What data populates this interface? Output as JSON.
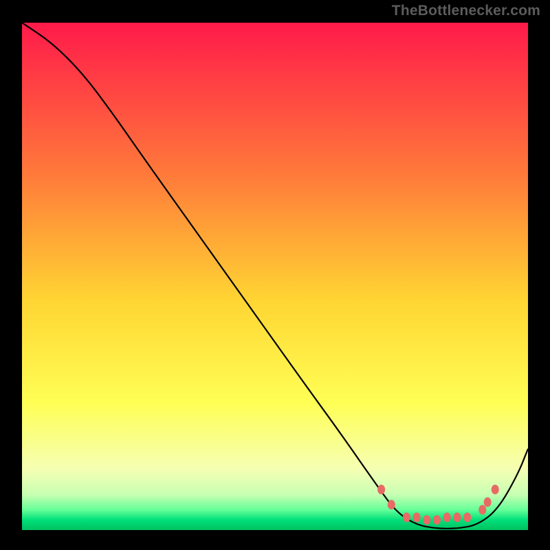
{
  "watermark": "TheBottlenecker.com",
  "chart_data": {
    "type": "line",
    "title": "",
    "xlabel": "",
    "ylabel": "",
    "xlim": [
      0,
      100
    ],
    "ylim": [
      0,
      100
    ],
    "grid": false,
    "series": [
      {
        "name": "bottleneck-curve",
        "x": [
          0,
          6,
          12,
          18,
          25,
          35,
          45,
          55,
          63,
          70,
          74,
          78,
          82,
          86,
          90,
          94,
          98,
          100
        ],
        "y": [
          100,
          96,
          90,
          82,
          72,
          58,
          44,
          30,
          19,
          9,
          3.5,
          1,
          0.3,
          0.3,
          1,
          4,
          11,
          16
        ]
      }
    ],
    "markers": {
      "name": "optimal-zone-markers",
      "color": "#e86a64",
      "points": [
        {
          "x": 71,
          "y": 8
        },
        {
          "x": 73,
          "y": 5
        },
        {
          "x": 76,
          "y": 2.5
        },
        {
          "x": 78,
          "y": 2.5
        },
        {
          "x": 80,
          "y": 2
        },
        {
          "x": 82,
          "y": 2
        },
        {
          "x": 84,
          "y": 2.5
        },
        {
          "x": 86,
          "y": 2.5
        },
        {
          "x": 88,
          "y": 2.5
        },
        {
          "x": 91,
          "y": 4
        },
        {
          "x": 92,
          "y": 5.5
        },
        {
          "x": 93.5,
          "y": 8
        }
      ]
    },
    "background_gradient": {
      "type": "vertical",
      "stops": [
        {
          "pos": 0,
          "color": "#ff1a4a"
        },
        {
          "pos": 30,
          "color": "#ff7a3a"
        },
        {
          "pos": 55,
          "color": "#ffd633"
        },
        {
          "pos": 75,
          "color": "#ffff55"
        },
        {
          "pos": 88,
          "color": "#f5ffb3"
        },
        {
          "pos": 93,
          "color": "#c8ffb3"
        },
        {
          "pos": 96,
          "color": "#66ff99"
        },
        {
          "pos": 98,
          "color": "#00e07a"
        },
        {
          "pos": 100,
          "color": "#00c060"
        }
      ]
    }
  }
}
